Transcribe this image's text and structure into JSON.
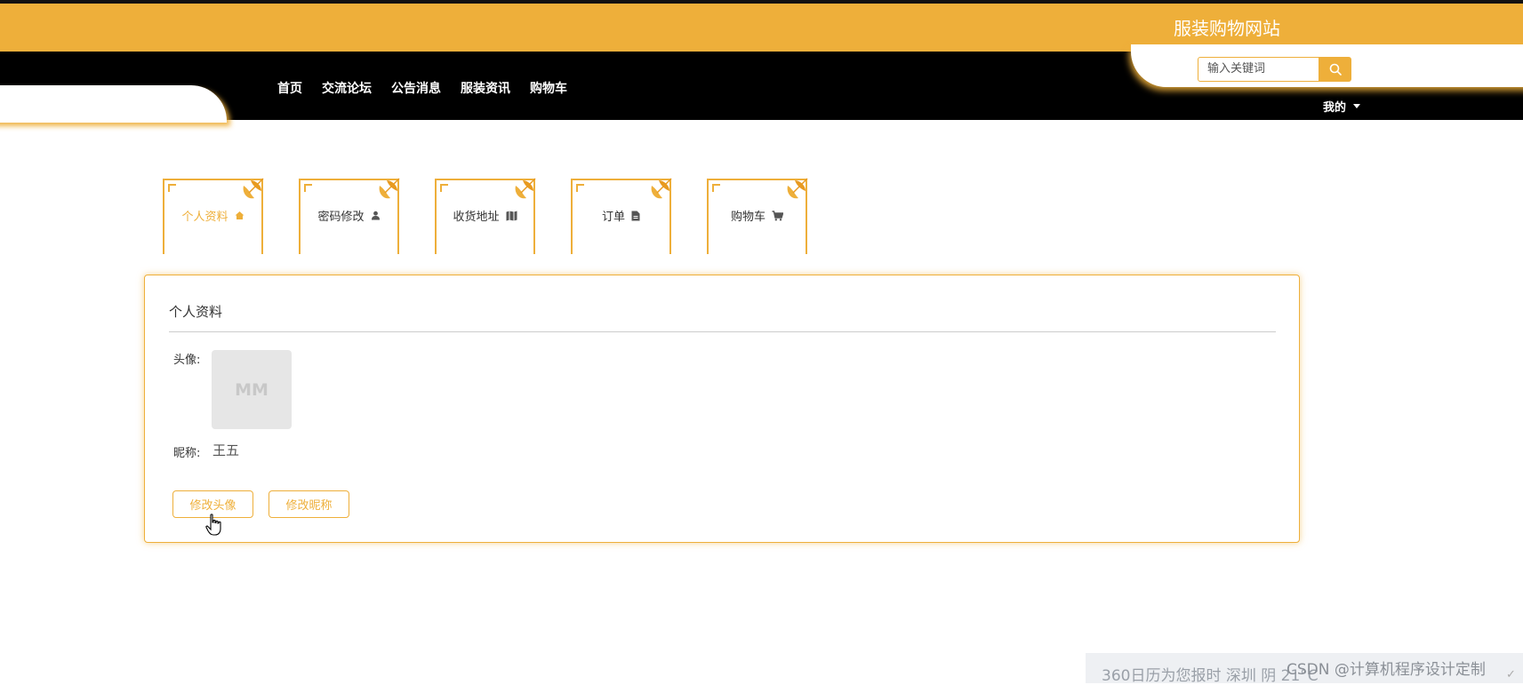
{
  "header": {
    "site_title": "服装购物网站",
    "search_placeholder": "输入关键词",
    "my_menu": "我的"
  },
  "nav": {
    "items": [
      {
        "label": "首页"
      },
      {
        "label": "交流论坛"
      },
      {
        "label": "公告消息"
      },
      {
        "label": "服装资讯"
      },
      {
        "label": "购物车"
      }
    ]
  },
  "tabs": [
    {
      "label": "个人资料",
      "icon": "home-icon",
      "active": true
    },
    {
      "label": "密码修改",
      "icon": "user-icon",
      "active": false
    },
    {
      "label": "收货地址",
      "icon": "map-icon",
      "active": false
    },
    {
      "label": "订单",
      "icon": "file-icon",
      "active": false
    },
    {
      "label": "购物车",
      "icon": "cart-icon",
      "active": false
    }
  ],
  "profile": {
    "title": "个人资料",
    "avatar_label": "头像:",
    "avatar_placeholder": "MM",
    "nickname_label": "昵称:",
    "nickname_value": "王五",
    "change_avatar_button": "修改头像",
    "change_nickname_button": "修改昵称"
  },
  "taskbar": {
    "weather_text": "360日历为您报时 深圳 阴 21°C",
    "watermark": "CSDN @计算机程序设计定制"
  },
  "colors": {
    "accent": "#EEAF3A",
    "nav_background": "#000000"
  }
}
